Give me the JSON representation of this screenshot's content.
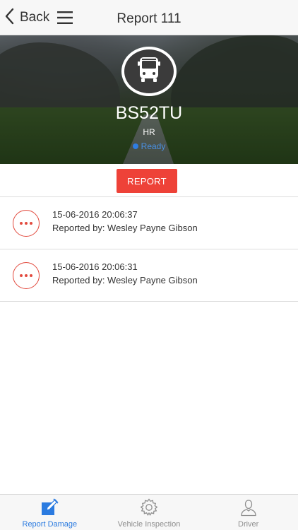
{
  "navbar": {
    "back_label": "Back",
    "title": "Report 111"
  },
  "vehicle": {
    "plate": "BS52TU",
    "subtype": "HR",
    "status": "Ready",
    "status_color": "#2f7de1"
  },
  "actions": {
    "report_label": "REPORT",
    "report_color": "#ee4238"
  },
  "reports": [
    {
      "datetime": "15-06-2016 20:06:37",
      "reported_by": "Reported by: Wesley Payne Gibson"
    },
    {
      "datetime": "15-06-2016 20:06:31",
      "reported_by": "Reported by: Wesley Payne Gibson"
    }
  ],
  "tabs": [
    {
      "label": "Report Damage",
      "icon": "edit-icon",
      "active": true
    },
    {
      "label": "Vehicle Inspection",
      "icon": "gear-icon",
      "active": false
    },
    {
      "label": "Driver",
      "icon": "person-icon",
      "active": false
    }
  ],
  "colors": {
    "accent_blue": "#2b7be0",
    "alert_red": "#e24a3e"
  }
}
